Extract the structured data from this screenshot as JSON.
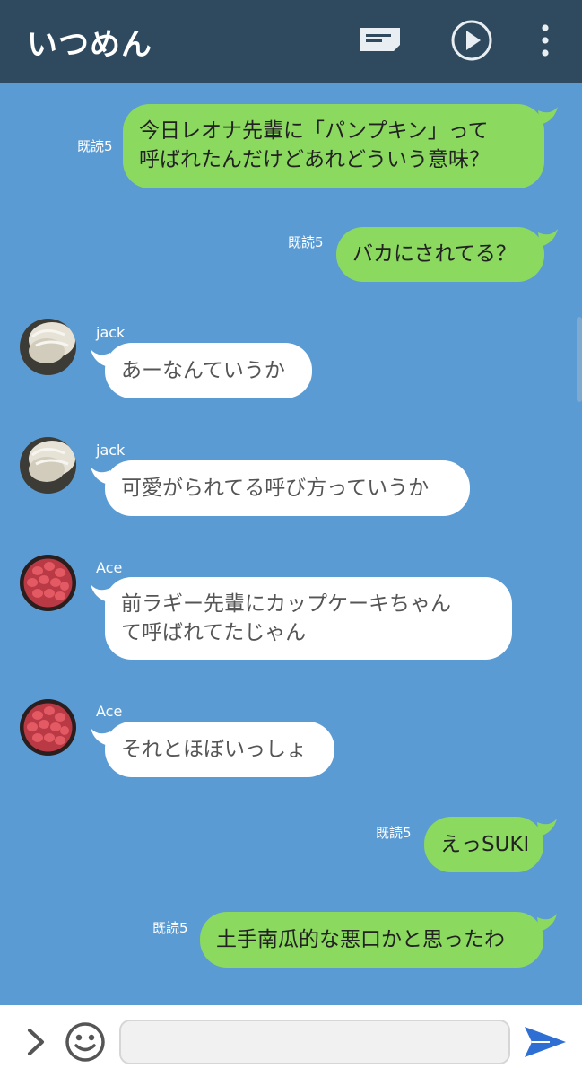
{
  "header": {
    "title": "いつめん",
    "icons": [
      "notes-icon",
      "play-circle-icon",
      "more-vertical-icon"
    ]
  },
  "colors": {
    "header_bg": "#2f4a5e",
    "chat_bg": "#5b9bd3",
    "outgoing_bubble": "#8bd95f",
    "incoming_bubble": "#ffffff",
    "send_icon": "#2f6fd4"
  },
  "messages": [
    {
      "direction": "out",
      "read": "既読5",
      "lines": [
        "今日レオナ先輩に「パンプキン」って",
        "呼ばれたんだけどあれどういう意味？"
      ]
    },
    {
      "direction": "out",
      "read": "既読5",
      "lines": [
        "バカにされてる？"
      ]
    },
    {
      "direction": "in",
      "sender": "jack",
      "avatar": "blond-hair-avatar",
      "lines": [
        "あーなんていうか"
      ]
    },
    {
      "direction": "in",
      "sender": "jack",
      "avatar": "blond-hair-avatar",
      "lines": [
        "可愛がられてる呼び方っていうか"
      ]
    },
    {
      "direction": "in",
      "sender": "Ace",
      "avatar": "strawberry-tart-avatar",
      "lines": [
        "前ラギー先輩にカップケーキちゃん",
        "て呼ばれてたじゃん"
      ]
    },
    {
      "direction": "in",
      "sender": "Ace",
      "avatar": "strawberry-tart-avatar",
      "lines": [
        "それとほぼいっしょ"
      ]
    },
    {
      "direction": "out",
      "read": "既読5",
      "lines": [
        "えっSUKI"
      ]
    },
    {
      "direction": "out",
      "read": "既読5",
      "lines": [
        "土手南瓜的な悪口かと思ったわ"
      ]
    }
  ],
  "footer": {
    "input_value": "",
    "icons": [
      "expand-chevron-icon",
      "emoji-icon",
      "send-icon"
    ]
  }
}
